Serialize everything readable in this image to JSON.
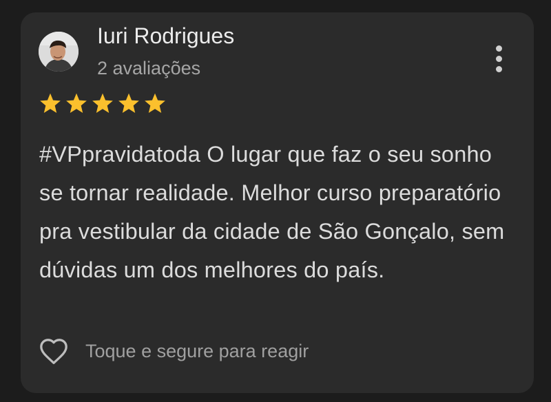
{
  "review": {
    "author_name": "Iuri Rodrigues",
    "author_reviews": "2 avaliações",
    "rating": 5,
    "rating_max": 5,
    "text": "#VPpravidatoda O lugar que faz o seu sonho se tornar realidade. Melhor curso preparatório pra vestibular da cidade de São Gonçalo, sem dúvidas um dos melhores do país.",
    "react_hint": "Toque e segure para reagir"
  },
  "icons": {
    "menu": "more-vert-icon",
    "react": "heart-outline-icon",
    "star": "star-icon"
  },
  "colors": {
    "background": "#1c1c1c",
    "card": "#2b2b2b",
    "star": "#fbc02d",
    "primary_text": "#ececec",
    "secondary_text": "#a6a6a6"
  }
}
